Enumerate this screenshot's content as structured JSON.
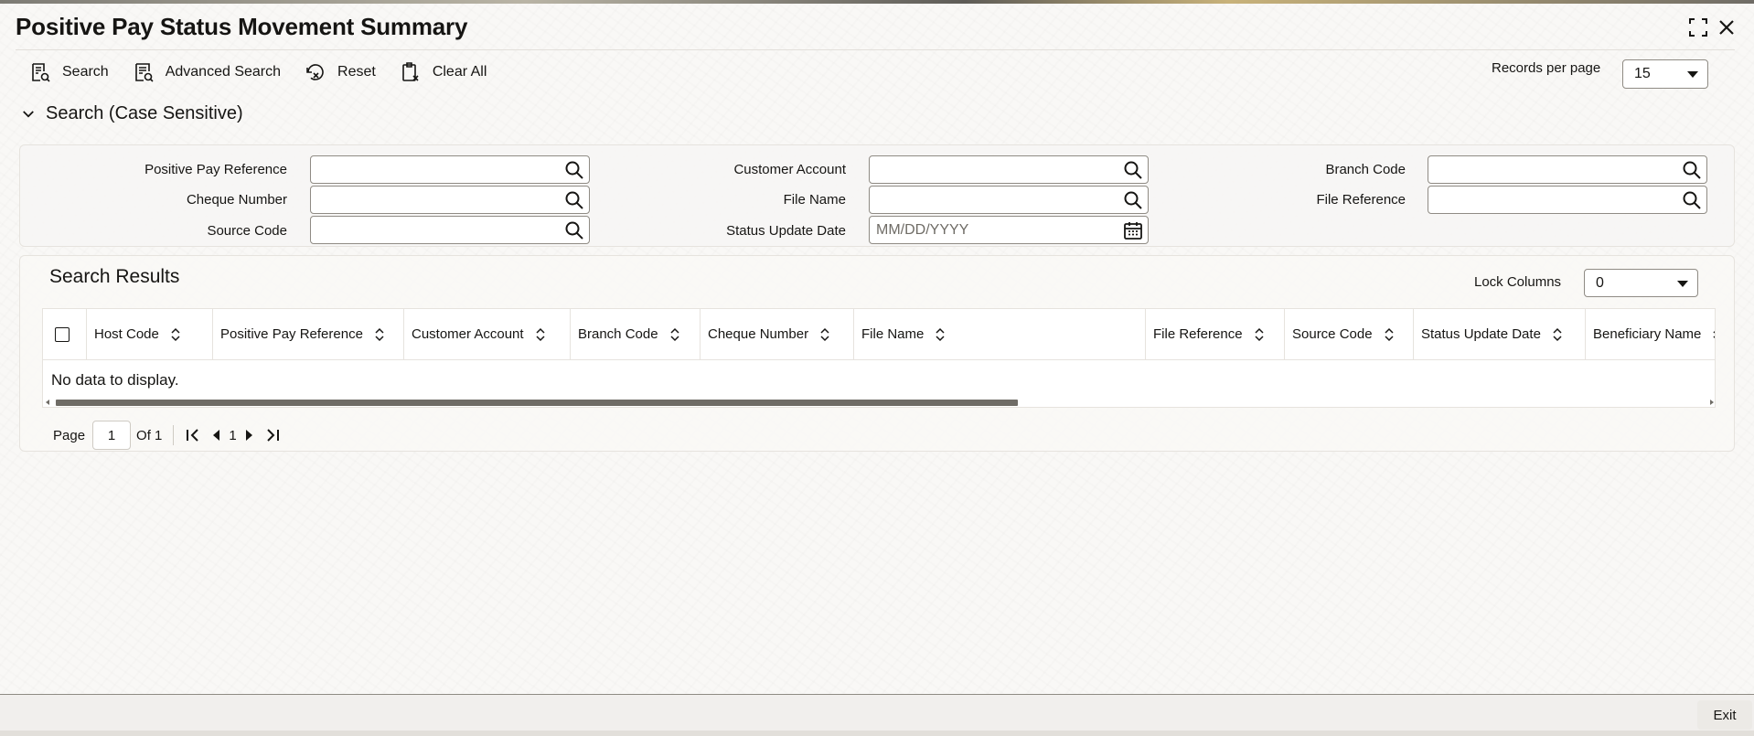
{
  "window": {
    "title": "Positive Pay Status Movement Summary"
  },
  "toolbar": {
    "search_label": "Search",
    "advanced_search_label": "Advanced Search",
    "reset_label": "Reset",
    "clear_all_label": "Clear All",
    "records_per_page_label": "Records per page",
    "records_per_page_value": "15"
  },
  "search_section": {
    "title": "Search (Case Sensitive)",
    "fields": {
      "positive_pay_reference": {
        "label": "Positive Pay Reference",
        "value": ""
      },
      "customer_account": {
        "label": "Customer Account",
        "value": ""
      },
      "branch_code": {
        "label": "Branch Code",
        "value": ""
      },
      "cheque_number": {
        "label": "Cheque Number",
        "value": ""
      },
      "file_name": {
        "label": "File Name",
        "value": ""
      },
      "file_reference": {
        "label": "File Reference",
        "value": ""
      },
      "source_code": {
        "label": "Source Code",
        "value": ""
      },
      "status_update_date": {
        "label": "Status Update Date",
        "placeholder": "MM/DD/YYYY"
      }
    }
  },
  "results": {
    "title": "Search Results",
    "lock_columns_label": "Lock Columns",
    "lock_columns_value": "0",
    "columns": [
      "Host Code",
      "Positive Pay Reference",
      "Customer Account",
      "Branch Code",
      "Cheque Number",
      "File Name",
      "File Reference",
      "Source Code",
      "Status Update Date",
      "Beneficiary Name"
    ],
    "empty_message": "No data to display."
  },
  "pagination": {
    "page_label": "Page",
    "current_page": "1",
    "of_label": "Of 1",
    "page_number": "1"
  },
  "footer": {
    "exit_label": "Exit"
  },
  "icons": {
    "search": "search-icon",
    "calendar": "calendar-icon",
    "sort": "sort-icon",
    "maximize": "maximize-icon",
    "close": "close-icon"
  }
}
